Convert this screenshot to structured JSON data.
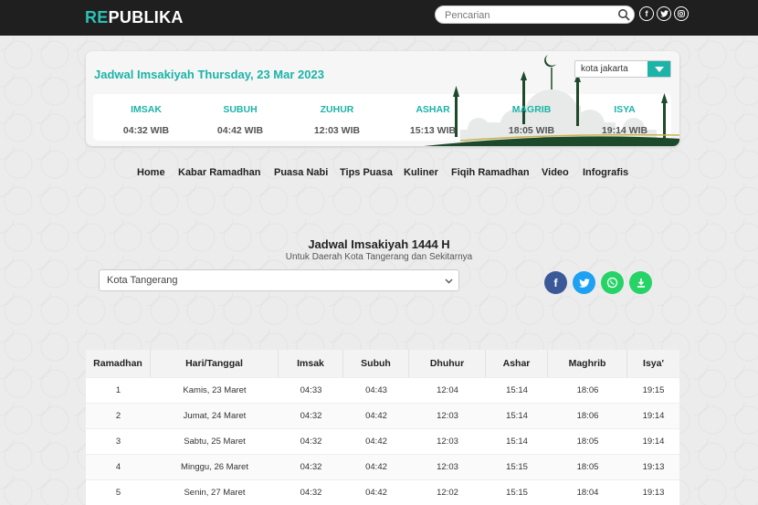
{
  "header": {
    "logo_re": "RE",
    "logo_publika": "PUBLIKA",
    "search_placeholder": "Pencarian",
    "social": [
      "facebook-icon",
      "twitter-icon",
      "instagram-icon"
    ]
  },
  "prayer_card": {
    "title": "Jadwal Imsakiyah Thursday, 23 Mar 2023",
    "city": "kota jakarta",
    "times": [
      {
        "name": "IMSAK",
        "time": "04:32 WIB"
      },
      {
        "name": "SUBUH",
        "time": "04:42 WIB"
      },
      {
        "name": "ZUHUR",
        "time": "12:03 WIB"
      },
      {
        "name": "ASHAR",
        "time": "15:13 WIB"
      },
      {
        "name": "MAGRIB",
        "time": "18:05 WIB"
      },
      {
        "name": "ISYA",
        "time": "19:14 WIB"
      }
    ]
  },
  "nav": [
    "Home",
    "Kabar Ramadhan",
    "Puasa Nabi",
    "Tips Puasa",
    "Kuliner",
    "Fiqih Ramadhan",
    "Video",
    "Infografis"
  ],
  "schedule": {
    "title": "Jadwal Imsakiyah 1444 H",
    "subtitle": "Untuk Daerah Kota Tangerang dan Sekitarnya",
    "region": "Kota Tangerang",
    "columns": [
      "Ramadhan",
      "Hari/Tanggal",
      "Imsak",
      "Subuh",
      "Dhuhur",
      "Ashar",
      "Maghrib",
      "Isya'"
    ],
    "rows": [
      [
        "1",
        "Kamis, 23 Maret",
        "04:33",
        "04:43",
        "12:04",
        "15:14",
        "18:06",
        "19:15"
      ],
      [
        "2",
        "Jumat, 24 Maret",
        "04:32",
        "04:42",
        "12:03",
        "15:14",
        "18:06",
        "19:14"
      ],
      [
        "3",
        "Sabtu, 25 Maret",
        "04:32",
        "04:42",
        "12:03",
        "15:14",
        "18:05",
        "19:14"
      ],
      [
        "4",
        "Minggu, 26 Maret",
        "04:32",
        "04:42",
        "12:03",
        "15:15",
        "18:05",
        "19:13"
      ],
      [
        "5",
        "Senin, 27 Maret",
        "04:32",
        "04:42",
        "12:02",
        "15:15",
        "18:04",
        "19:13"
      ]
    ]
  },
  "colors": {
    "accent": "#1cb3a8",
    "dark_green": "#1d4a2a",
    "facebook": "#3b5998",
    "twitter": "#1da1f2",
    "whatsapp": "#25d366"
  }
}
